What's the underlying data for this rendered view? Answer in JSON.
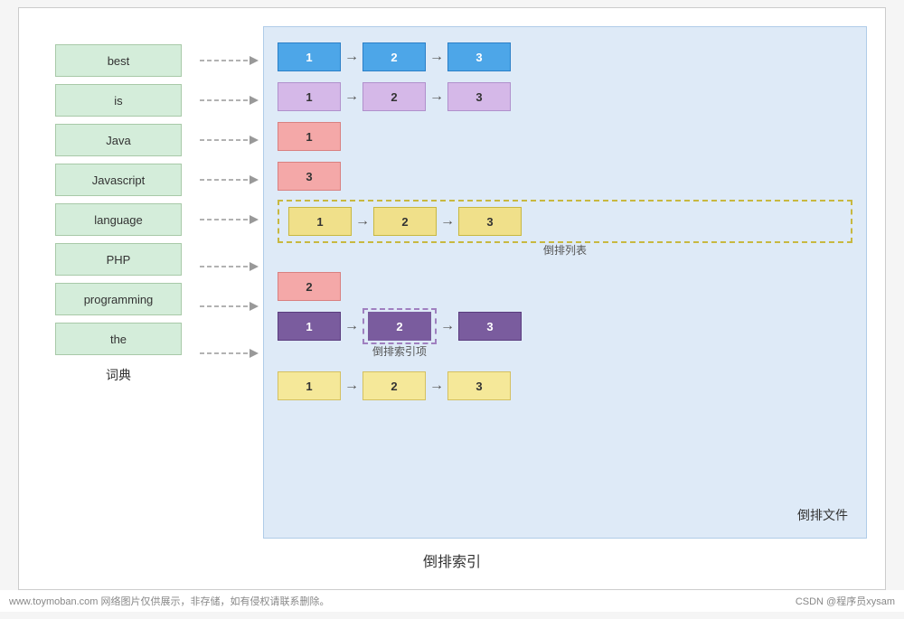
{
  "title": "倒排索引",
  "dictionary": {
    "label": "词典",
    "items": [
      {
        "word": "best"
      },
      {
        "word": "is"
      },
      {
        "word": "Java"
      },
      {
        "word": "Javascript"
      },
      {
        "word": "language"
      },
      {
        "word": "PHP"
      },
      {
        "word": "programming"
      },
      {
        "word": "the"
      }
    ]
  },
  "inverted_file": {
    "label": "倒排文件",
    "rows": [
      {
        "type": "blue",
        "nodes": [
          "1",
          "2",
          "3"
        ]
      },
      {
        "type": "lavender",
        "nodes": [
          "1",
          "2",
          "3"
        ]
      },
      {
        "type": "pink",
        "nodes": [
          "1"
        ]
      },
      {
        "type": "pink",
        "nodes": [
          "3"
        ]
      },
      {
        "type": "inv-list",
        "nodes": [
          "1",
          "2",
          "3"
        ],
        "box_label": "倒排列表"
      },
      {
        "type": "pink",
        "nodes": [
          "2"
        ]
      },
      {
        "type": "purple",
        "nodes": [
          "1",
          "2",
          "3"
        ],
        "highlight_index": 1,
        "box_label": "倒排索引项"
      },
      {
        "type": "yellow-light",
        "nodes": [
          "1",
          "2",
          "3"
        ]
      }
    ]
  },
  "footer": {
    "left": "www.toymoban.com 网络图片仅供展示，非存储，如有侵权请联系删除。",
    "right": "CSDN @程序员xysam"
  }
}
